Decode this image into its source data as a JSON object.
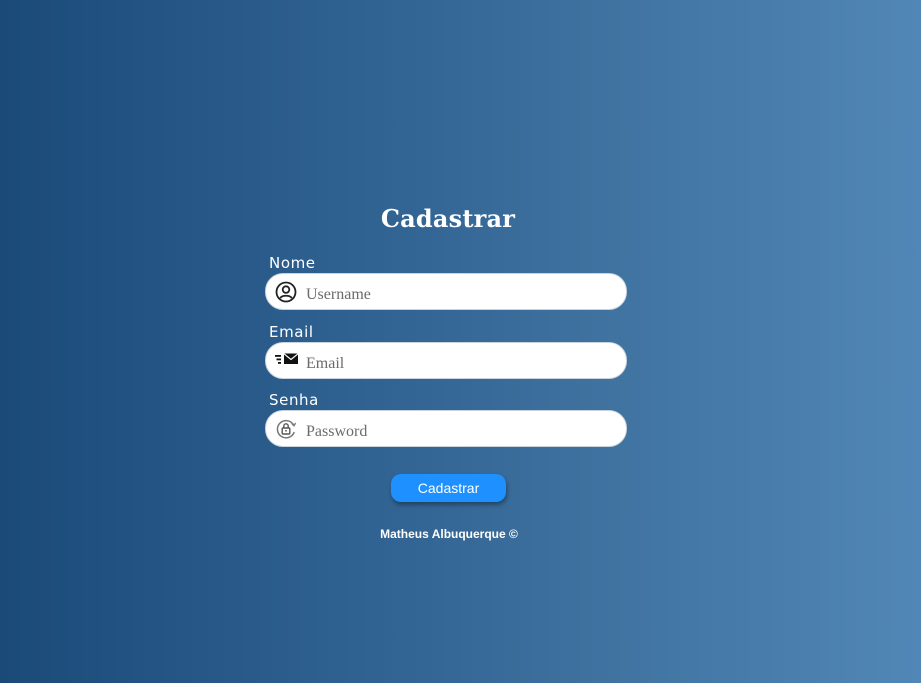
{
  "form": {
    "title": "Cadastrar",
    "fields": [
      {
        "label": "Nome",
        "placeholder": "Username",
        "icon": "user-circle-icon"
      },
      {
        "label": "Email",
        "placeholder": "Email",
        "icon": "mail-icon"
      },
      {
        "label": "Senha",
        "placeholder": "Password",
        "icon": "lock-icon"
      }
    ],
    "submit_label": "Cadastrar"
  },
  "footer": {
    "text": "Matheus Albuquerque ©"
  },
  "colors": {
    "background_left": "#1b4a78",
    "background_right": "#5187b6",
    "button": "#1e90ff"
  }
}
